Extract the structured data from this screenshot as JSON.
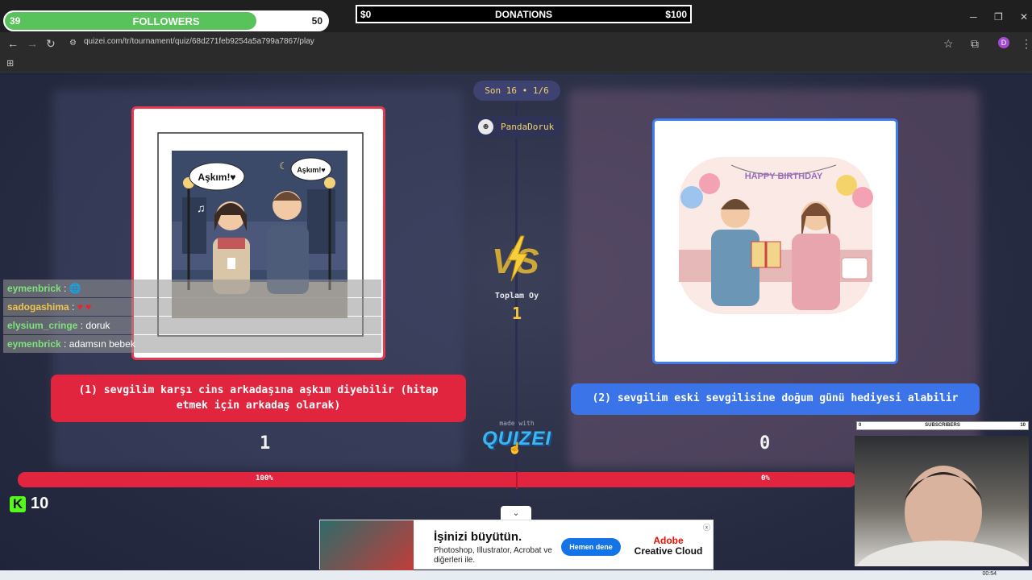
{
  "overlay": {
    "followers": {
      "label": "FOLLOWERS",
      "current": "39",
      "goal": "50",
      "progress_fraction": 0.78
    },
    "donations": {
      "label": "DONATIONS",
      "min": "$0",
      "max": "$100"
    },
    "subscribers": {
      "label": "SUBSCRIBERS",
      "min": "0",
      "max": "10"
    },
    "kick": {
      "icon": "kick-logo-icon",
      "count": "10"
    }
  },
  "browser": {
    "url": "quizei.com/tr/tournament/quiz/68d271feb9254a5a799a7867/play",
    "profile_initial": "D"
  },
  "quiz": {
    "round_label": "Son 16 • 1/6",
    "username": "PandaDoruk",
    "total_votes_label": "Toplam Oy",
    "total_votes": "1",
    "made_with": "made with",
    "brand": "QUIZEI",
    "left": {
      "question": "(1) sevgilim karşı cins arkadaşına aşkım diyebilir (hitap etmek için arkadaş olarak)",
      "votes": "1",
      "percent": "100%",
      "bubble_left": "Aşkım!♥",
      "bubble_right": "Aşkım!♥"
    },
    "right": {
      "question": "(2) sevgilim eski sevgilisine doğum günü hediyesi alabilir",
      "votes": "0",
      "percent": "0%",
      "banner": "HAPPY BIRTHDAY"
    },
    "colors": {
      "left": "#e2253f",
      "right": "#3b73e8",
      "accent": "#f5c842"
    }
  },
  "chat": [
    {
      "user": "eymenbrick",
      "message": "🌐"
    },
    {
      "user": "sadogashima",
      "message": "♥ ♥"
    },
    {
      "user": "elysium_cringe",
      "message": "doruk"
    },
    {
      "user": "eymenbrick",
      "message": "adamsın bebek"
    }
  ],
  "ad": {
    "title": "İşinizi büyütün.",
    "subtitle": "Photoshop, Illustrator, Acrobat ve diğerleri ile.",
    "button": "Hemen dene",
    "brand_line1": "Adobe",
    "brand_line2": "Creative Cloud"
  },
  "taskbar": {
    "time": "00:54"
  }
}
